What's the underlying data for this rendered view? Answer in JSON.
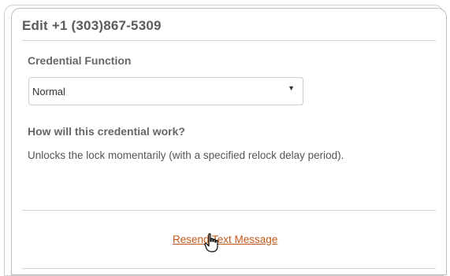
{
  "dialog": {
    "title": "Edit +1 (303)867-5309"
  },
  "credential_function": {
    "label": "Credential Function",
    "selected": "Normal"
  },
  "how_it_works": {
    "heading": "How will this credential work?",
    "description": "Unlocks the lock momentarily (with a specified relock delay period)."
  },
  "actions": {
    "resend_link": "Resend Text Message"
  },
  "colors": {
    "link": "#c2571a",
    "heading": "#5b5b5b"
  },
  "icons": {
    "select_arrow": "triangle-down-icon",
    "cursor": "hand-pointer-icon"
  }
}
